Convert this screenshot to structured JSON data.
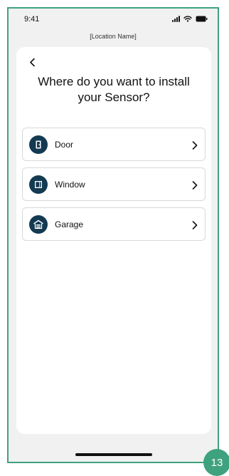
{
  "status_bar": {
    "time": "9:41",
    "icons": [
      "signal-icon",
      "wifi-icon",
      "battery-icon"
    ]
  },
  "header": {
    "location_name": "[Location Name]"
  },
  "main": {
    "back_icon": "chevron-left-icon",
    "title": "Where do you want to install your Sensor?",
    "options": [
      {
        "label": "Door",
        "icon": "door-icon"
      },
      {
        "label": "Window",
        "icon": "window-icon"
      },
      {
        "label": "Garage",
        "icon": "garage-icon"
      }
    ]
  },
  "page_badge": "13",
  "colors": {
    "accent": "#3fa27e",
    "icon_background": "#143a52",
    "background": "#f0f1f0",
    "card": "#ffffff"
  }
}
